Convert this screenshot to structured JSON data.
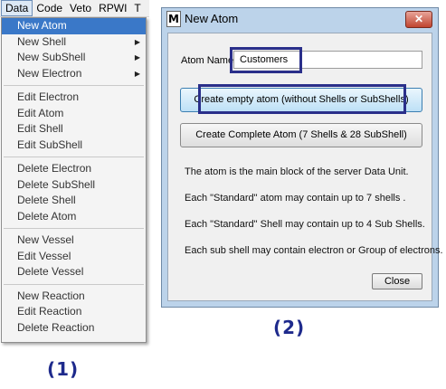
{
  "menubar": {
    "items": [
      "Data",
      "Code",
      "Veto",
      "RPWI",
      "T"
    ]
  },
  "menu": {
    "groups": [
      [
        {
          "label": "New Atom",
          "highlighted": true,
          "submenu": false
        },
        {
          "label": "New Shell",
          "submenu": true
        },
        {
          "label": "New SubShell",
          "submenu": true
        },
        {
          "label": "New Electron",
          "submenu": true
        }
      ],
      [
        {
          "label": "Edit Electron"
        },
        {
          "label": "Edit Atom"
        },
        {
          "label": "Edit Shell"
        },
        {
          "label": "Edit SubShell"
        }
      ],
      [
        {
          "label": "Delete Electron"
        },
        {
          "label": "Delete SubShell"
        },
        {
          "label": "Delete Shell"
        },
        {
          "label": "Delete Atom"
        }
      ],
      [
        {
          "label": "New Vessel"
        },
        {
          "label": "Edit Vessel"
        },
        {
          "label": "Delete Vessel"
        }
      ],
      [
        {
          "label": "New Reaction"
        },
        {
          "label": "Edit Reaction"
        },
        {
          "label": "Delete Reaction"
        }
      ]
    ],
    "submenu_arrow": "▶"
  },
  "labels": {
    "menu_badge": "(1)",
    "dialog_badge": "(2)"
  },
  "dialog": {
    "icon": "M",
    "title": "New Atom",
    "close_glyph": "✕",
    "atom_name_label": "Atom Name:",
    "atom_name_value": "Customers",
    "btn_empty": "Create empty atom (without Shells or SubShells)",
    "btn_complete": "Create Complete Atom (7 Shells & 28 SubShell)",
    "info": [
      "The atom is the main block of the server Data Unit.",
      "Each \"Standard\" atom may contain up to 7 shells .",
      "Each \"Standard\" Shell may contain up to 4 Sub Shells.",
      "Each sub shell may contain electron or Group of electrons."
    ],
    "close_button": "Close"
  },
  "colors": {
    "menu_highlight": "#3a78c8",
    "annotation_border": "#2a2f8a",
    "dialog_frame": "#bcd3ea"
  }
}
